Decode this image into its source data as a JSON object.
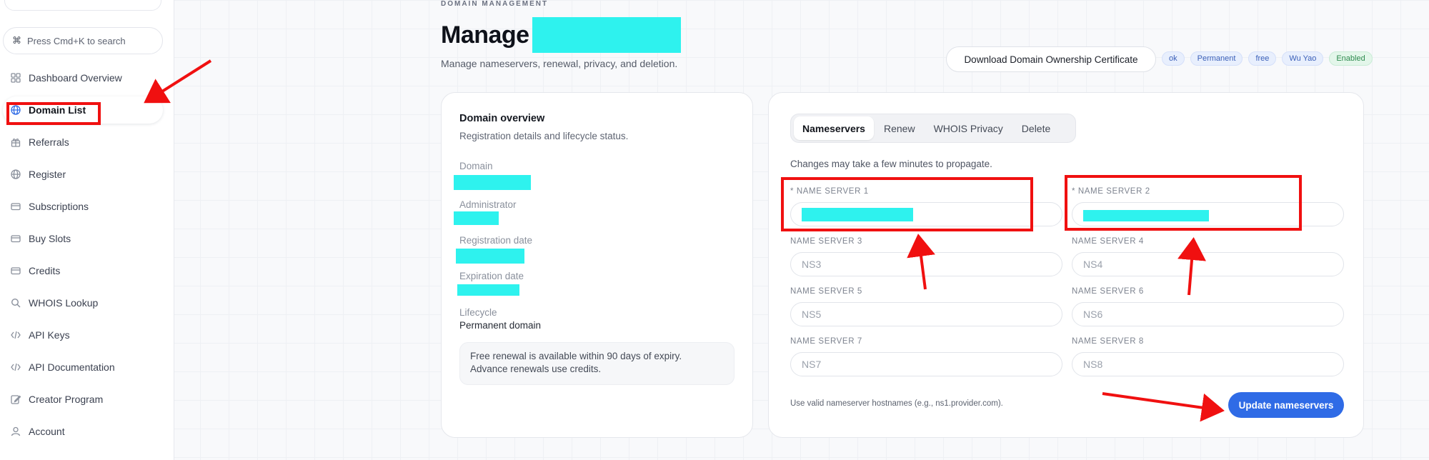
{
  "sidebar": {
    "search_placeholder": "Press Cmd+K to search",
    "items": [
      {
        "label": "Dashboard Overview",
        "icon": "grid-icon"
      },
      {
        "label": "Domain List",
        "icon": "globe-icon",
        "active": true
      },
      {
        "label": "Referrals",
        "icon": "gift-icon"
      },
      {
        "label": "Register",
        "icon": "globe-icon"
      },
      {
        "label": "Subscriptions",
        "icon": "card-icon"
      },
      {
        "label": "Buy Slots",
        "icon": "card-icon"
      },
      {
        "label": "Credits",
        "icon": "card-icon"
      },
      {
        "label": "WHOIS Lookup",
        "icon": "search-icon"
      },
      {
        "label": "API Keys",
        "icon": "code-icon"
      },
      {
        "label": "API Documentation",
        "icon": "code-icon"
      },
      {
        "label": "Creator Program",
        "icon": "edit-icon"
      },
      {
        "label": "Account",
        "icon": "user-icon"
      }
    ]
  },
  "header": {
    "eyebrow": "DOMAIN MANAGEMENT",
    "title": "Manage",
    "subtitle": "Manage nameservers, renewal, privacy, and deletion.",
    "cert_button": "Download Domain Ownership Certificate",
    "badges": [
      "ok",
      "Permanent",
      "free",
      "Wu Yao",
      "Enabled"
    ]
  },
  "overview": {
    "title": "Domain overview",
    "subtitle": "Registration details and lifecycle status.",
    "fields": {
      "domain": "Domain",
      "administrator": "Administrator",
      "registration_date": "Registration date",
      "expiration_date": "Expiration date",
      "lifecycle": "Lifecycle",
      "lifecycle_value": "Permanent domain"
    },
    "note_line1": "Free renewal is available within 90 days of expiry.",
    "note_line2": "Advance renewals use credits."
  },
  "nameservers": {
    "tabs": [
      "Nameservers",
      "Renew",
      "WHOIS Privacy",
      "Delete"
    ],
    "hint": "Changes may take a few minutes to propagate.",
    "labels": [
      "* NAME SERVER 1",
      "* NAME SERVER 2",
      "NAME SERVER 3",
      "NAME SERVER 4",
      "NAME SERVER 5",
      "NAME SERVER 6",
      "NAME SERVER 7",
      "NAME SERVER 8"
    ],
    "placeholders": [
      "",
      "",
      "NS3",
      "NS4",
      "NS5",
      "NS6",
      "NS7",
      "NS8"
    ],
    "footer_hint": "Use valid nameserver hostnames (e.g., ns1.provider.com).",
    "update_button": "Update nameservers"
  },
  "colors": {
    "accent": "#2f6be6",
    "annotation": "#f01010",
    "redaction": "#2ef2ee"
  }
}
